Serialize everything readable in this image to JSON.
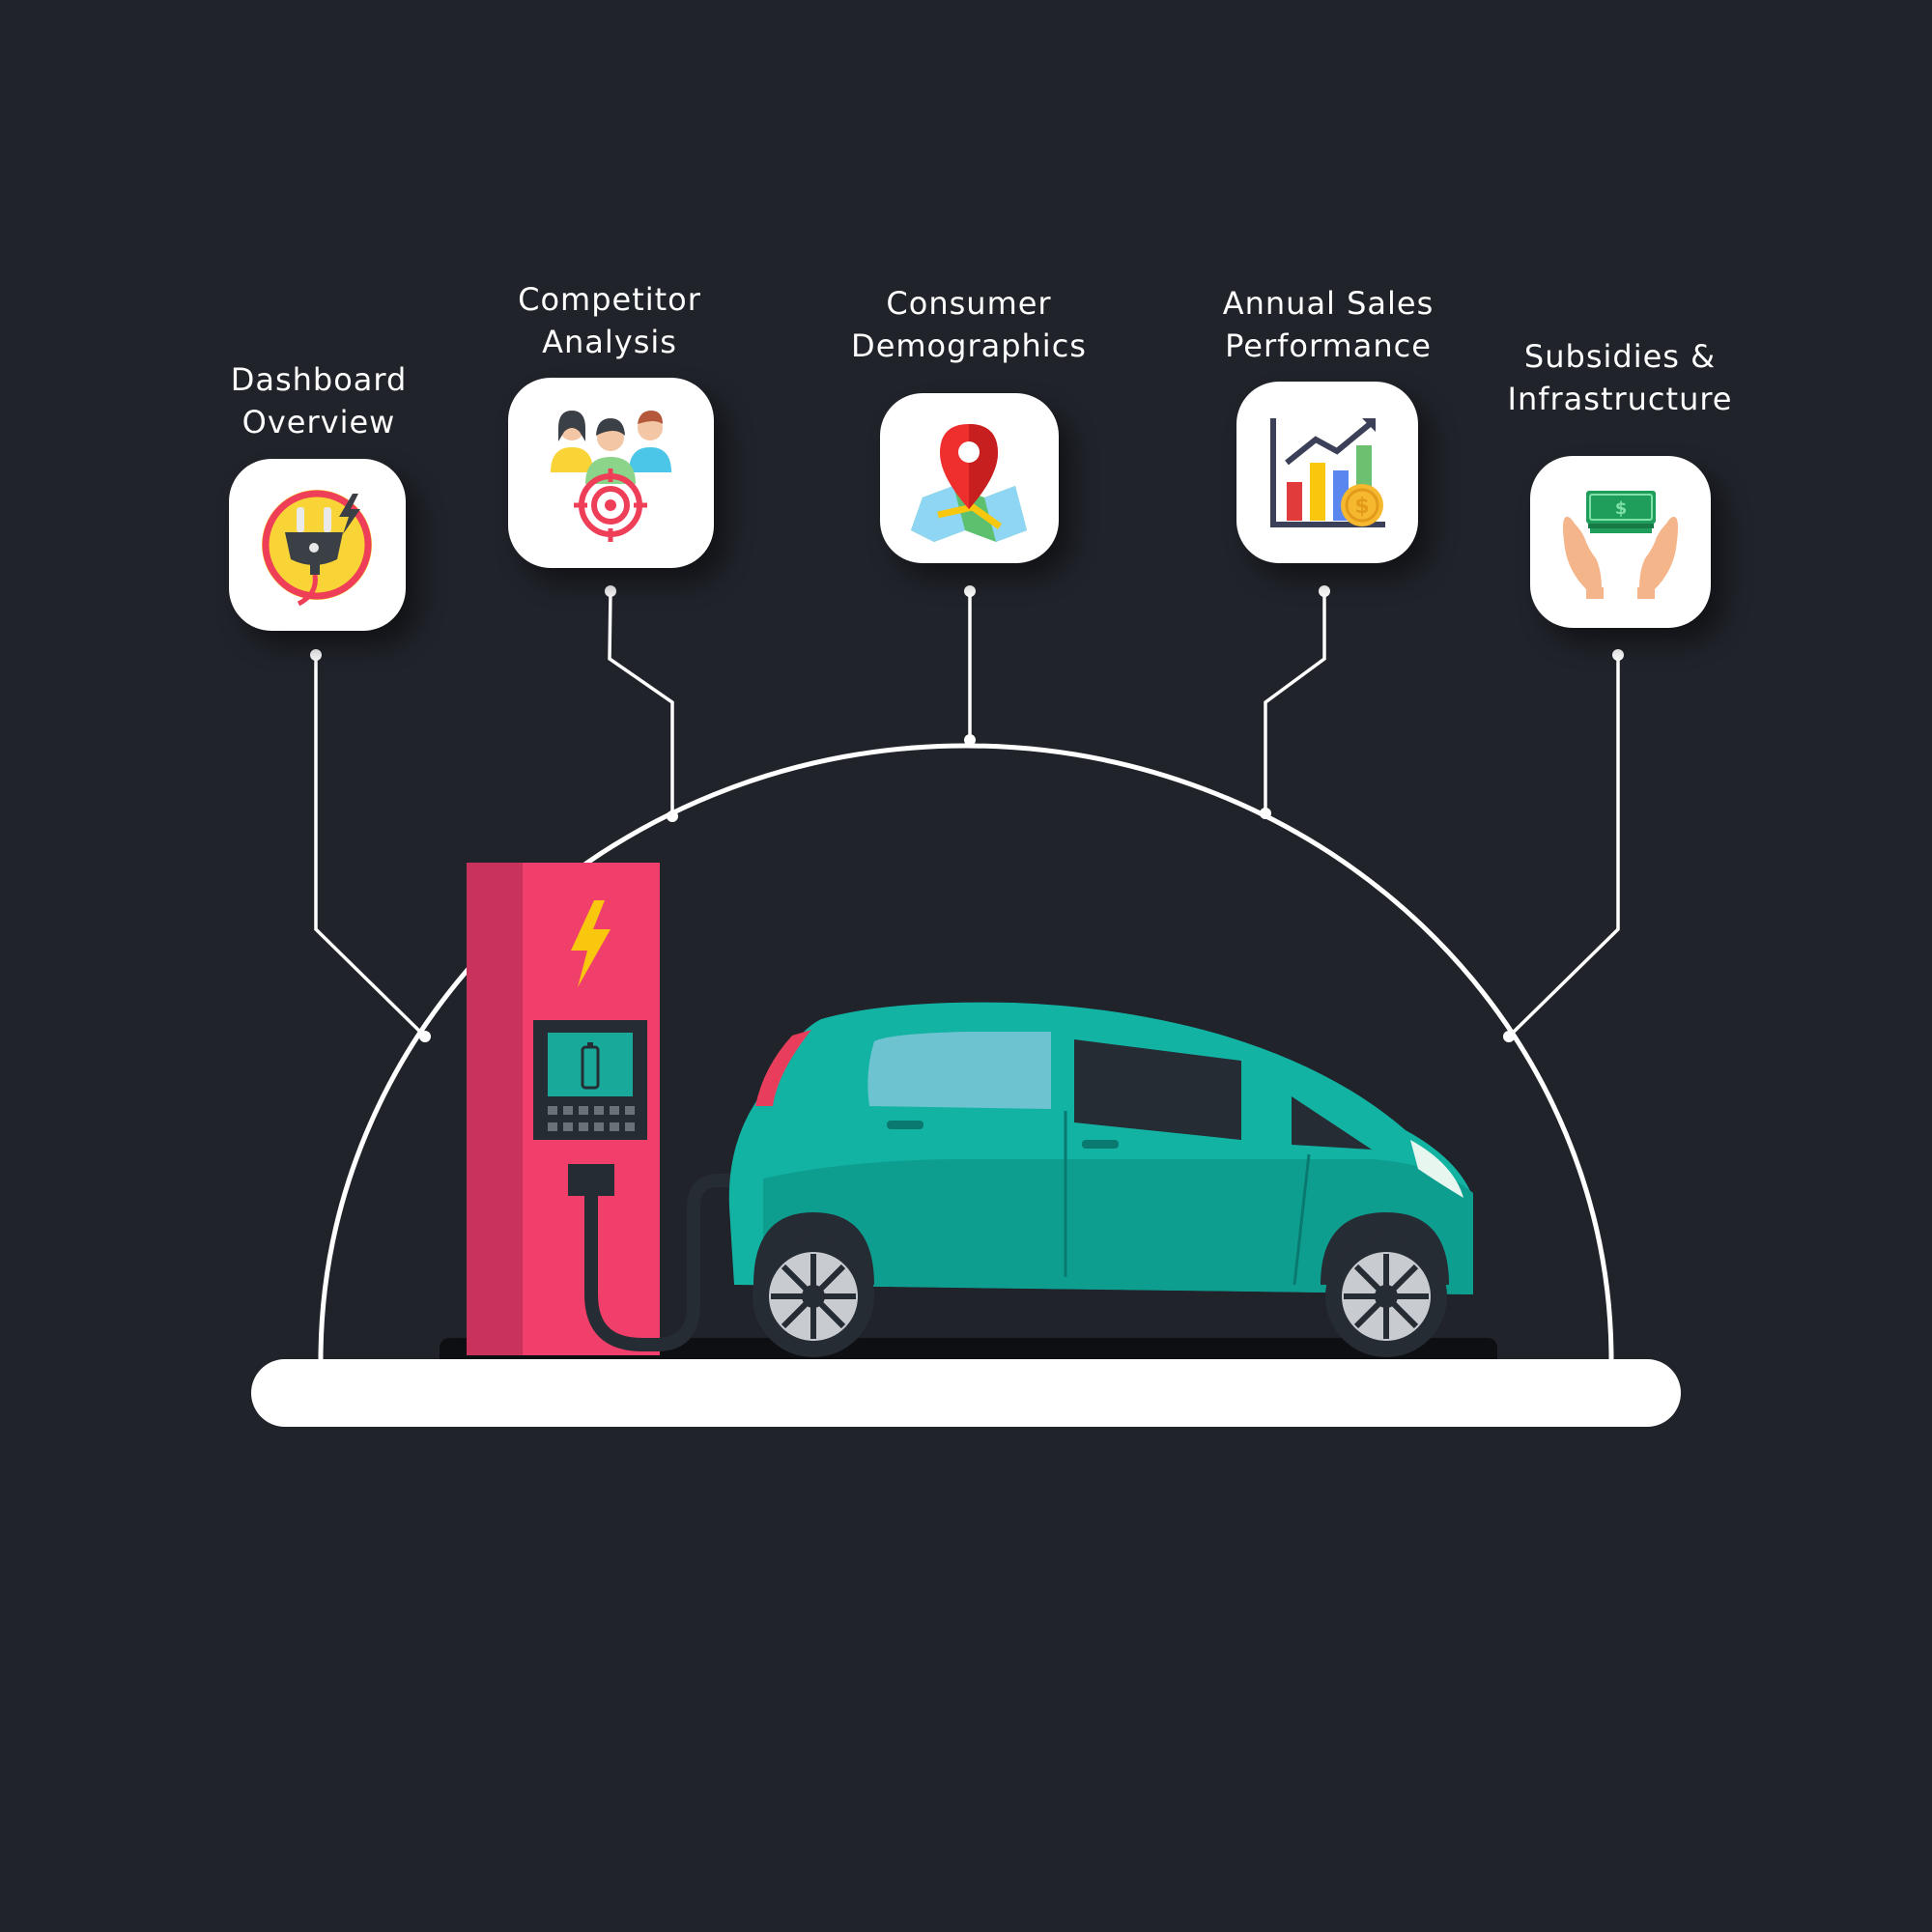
{
  "colors": {
    "background": "#20232a",
    "line": "#ffffff",
    "charger": "#f03f6b",
    "car": "#12b5a6"
  },
  "nav_items": [
    {
      "id": "dashboard",
      "line1": "Dashboard",
      "line2": "Overview",
      "icon": "power-plug-icon"
    },
    {
      "id": "competitor",
      "line1": "Competitor",
      "line2": "Analysis",
      "icon": "target-audience-icon"
    },
    {
      "id": "consumer",
      "line1": "Consumer",
      "line2": "Demographics",
      "icon": "map-pin-icon"
    },
    {
      "id": "sales",
      "line1": "Annual Sales",
      "line2": "Performance",
      "icon": "bar-chart-icon"
    },
    {
      "id": "subsidies",
      "line1": "Subsidies &",
      "line2": "Infrastructure",
      "icon": "money-hands-icon"
    }
  ]
}
